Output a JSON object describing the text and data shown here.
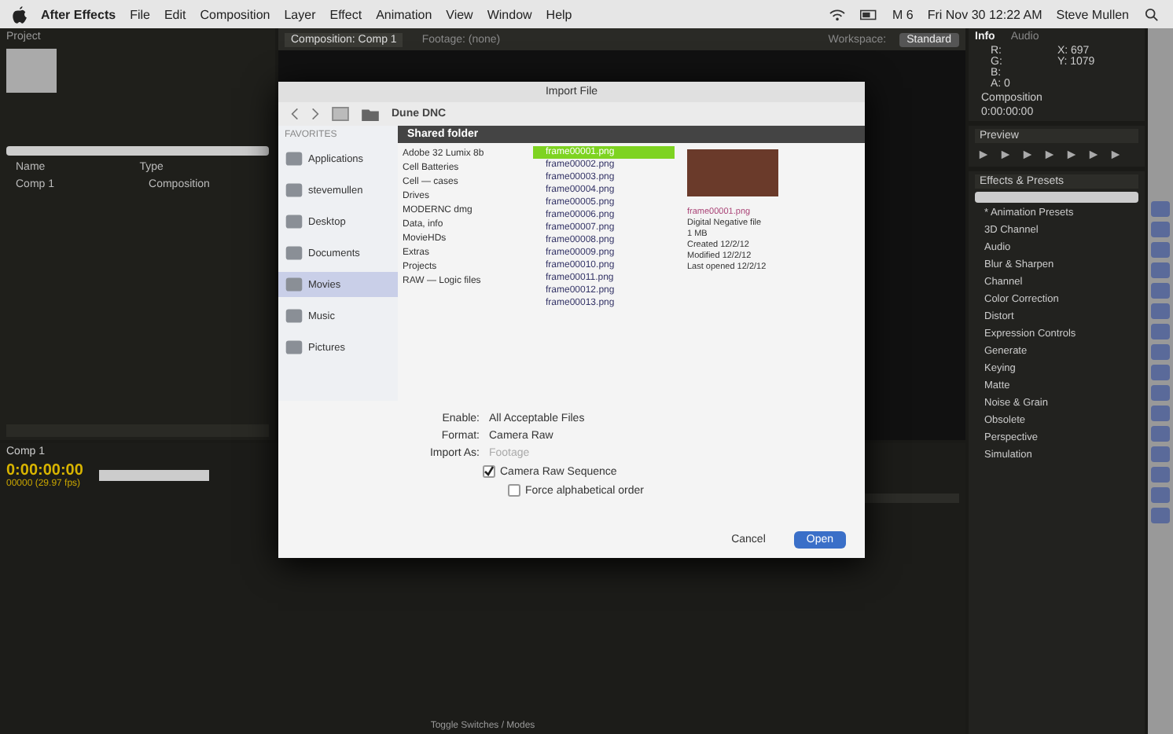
{
  "menu_bar": {
    "items": [
      "After Effects",
      "File",
      "Edit",
      "Composition",
      "Layer",
      "Effect",
      "Animation",
      "View",
      "Window",
      "Help"
    ],
    "status": [
      "M 6",
      "Fri Nov 30  12:22 AM",
      "Steve Mullen"
    ]
  },
  "project_panel": {
    "title": "Project",
    "columns": [
      "Name",
      "Type"
    ],
    "items": [
      {
        "name": "Comp 1",
        "type": "Composition"
      }
    ]
  },
  "composition_panel": {
    "tabs": [
      {
        "label": "Composition: Comp 1",
        "selected": true
      },
      {
        "label": "Footage: (none)",
        "selected": false
      }
    ]
  },
  "workspace": {
    "label": "Workspace:",
    "value": "Standard"
  },
  "info_panel": {
    "tabs": [
      {
        "label": "Info",
        "selected": true
      },
      {
        "label": "Audio",
        "selected": false
      }
    ],
    "lines": [
      "R:",
      "G:",
      "B:",
      "A: 0"
    ],
    "coords": [
      "X: 697",
      "Y: 1079"
    ],
    "footer": [
      "Composition",
      "0:00:00:00"
    ]
  },
  "preview_panel": {
    "title": "Preview"
  },
  "effects_panel": {
    "title": "Effects & Presets",
    "items": [
      "* Animation Presets",
      "3D Channel",
      "Audio",
      "Blur & Sharpen",
      "Channel",
      "Color Correction",
      "Distort",
      "Expression Controls",
      "Generate",
      "Keying",
      "Matte",
      "Noise & Grain",
      "Obsolete",
      "Perspective",
      "Simulation"
    ]
  },
  "timeline": {
    "tab": "Comp 1",
    "timecode": "0:00:00:00",
    "fps": "00000 (29.97 fps)",
    "toggle": "Toggle Switches / Modes"
  },
  "dialog": {
    "title": "Import File",
    "path": "Dune DNC",
    "sidebar_heading": "FAVORITES",
    "sidebar": [
      {
        "label": "Applications",
        "selected": false
      },
      {
        "label": "stevemullen",
        "selected": false
      },
      {
        "label": "Desktop",
        "selected": false
      },
      {
        "label": "Documents",
        "selected": false
      },
      {
        "label": "Movies",
        "selected": true
      },
      {
        "label": "Music",
        "selected": false
      },
      {
        "label": "Pictures",
        "selected": false
      }
    ],
    "column_heading": "Shared folder",
    "folders": [
      "Adobe 32 Lumix 8b",
      "Cell Batteries",
      "Cell — cases",
      "Drives",
      "MODERNC dmg",
      "Data, info",
      "MovieHDs",
      "Extras",
      "Projects",
      "RAW — Logic files"
    ],
    "files": [
      {
        "name": "frame00001.png",
        "selected": true
      },
      {
        "name": "frame00002.png",
        "selected": false
      },
      {
        "name": "frame00003.png",
        "selected": false
      },
      {
        "name": "frame00004.png",
        "selected": false
      },
      {
        "name": "frame00005.png",
        "selected": false
      },
      {
        "name": "frame00006.png",
        "selected": false
      },
      {
        "name": "frame00007.png",
        "selected": false
      },
      {
        "name": "frame00008.png",
        "selected": false
      },
      {
        "name": "frame00009.png",
        "selected": false
      },
      {
        "name": "frame00010.png",
        "selected": false
      },
      {
        "name": "frame00011.png",
        "selected": false
      },
      {
        "name": "frame00012.png",
        "selected": false
      },
      {
        "name": "frame00013.png",
        "selected": false
      }
    ],
    "preview_info": [
      "frame00001.png",
      "Digital Negative file",
      "1 MB",
      "Created 12/2/12",
      "Modified 12/2/12",
      "Last opened 12/2/12"
    ],
    "enable": {
      "label": "Enable:",
      "value": "All Acceptable Files"
    },
    "format": {
      "label": "Format:",
      "value": "Camera Raw"
    },
    "import_as": {
      "label": "Import As:",
      "value": "Footage"
    },
    "options": [
      {
        "label": "Camera Raw Sequence",
        "checked": true
      },
      {
        "label": "Force alphabetical order",
        "checked": false
      }
    ],
    "buttons": [
      {
        "label": "Cancel",
        "kind": "secondary"
      },
      {
        "label": "Open",
        "kind": "primary"
      }
    ]
  }
}
